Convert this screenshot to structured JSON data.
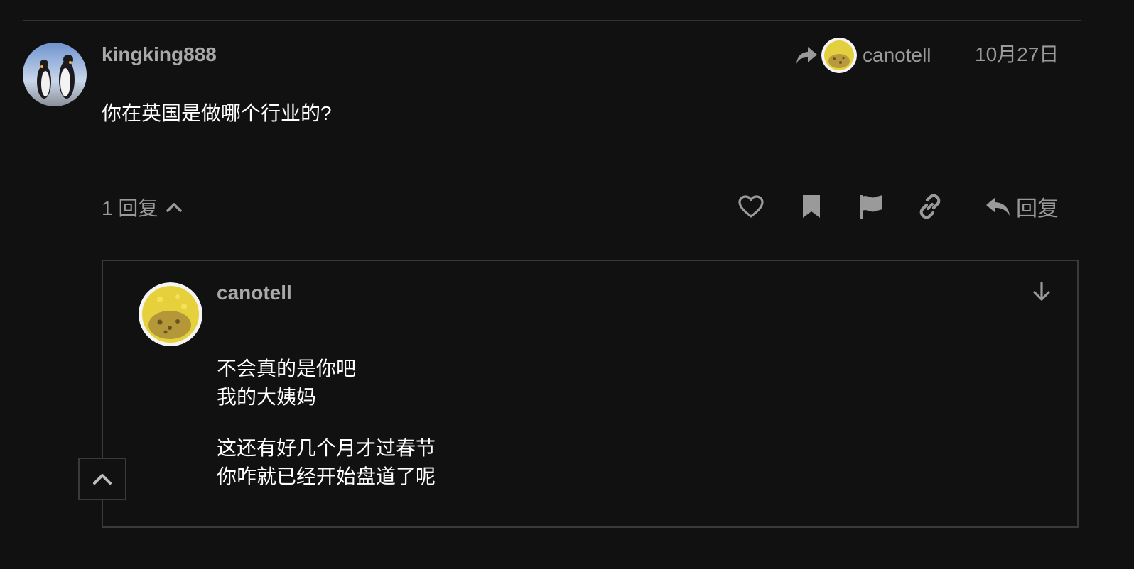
{
  "post": {
    "username": "kingking888",
    "reply_to_username": "canotell",
    "date": "10月27日",
    "body": "你在英国是做哪个行业的?",
    "replies_count_label": "1 回复",
    "reply_button_label": "回复"
  },
  "embedded_reply": {
    "username": "canotell",
    "paragraphs": [
      [
        "不会真的是你吧",
        "我的大姨妈"
      ],
      [
        "这还有好几个月才过春节",
        "你咋就已经开始盘道了呢"
      ]
    ]
  },
  "icons": {
    "share": "share-arrow-icon",
    "like": "heart-icon",
    "bookmark": "bookmark-icon",
    "flag": "flag-icon",
    "link": "link-icon",
    "reply": "reply-arrow-icon",
    "collapse": "chevron-up-icon",
    "jump": "arrow-down-icon",
    "scroll_top": "chevron-up-icon"
  },
  "colors": {
    "background": "#111111",
    "text_primary": "#ffffff",
    "text_muted": "#9a9a9a",
    "border": "#3a3a3a"
  }
}
